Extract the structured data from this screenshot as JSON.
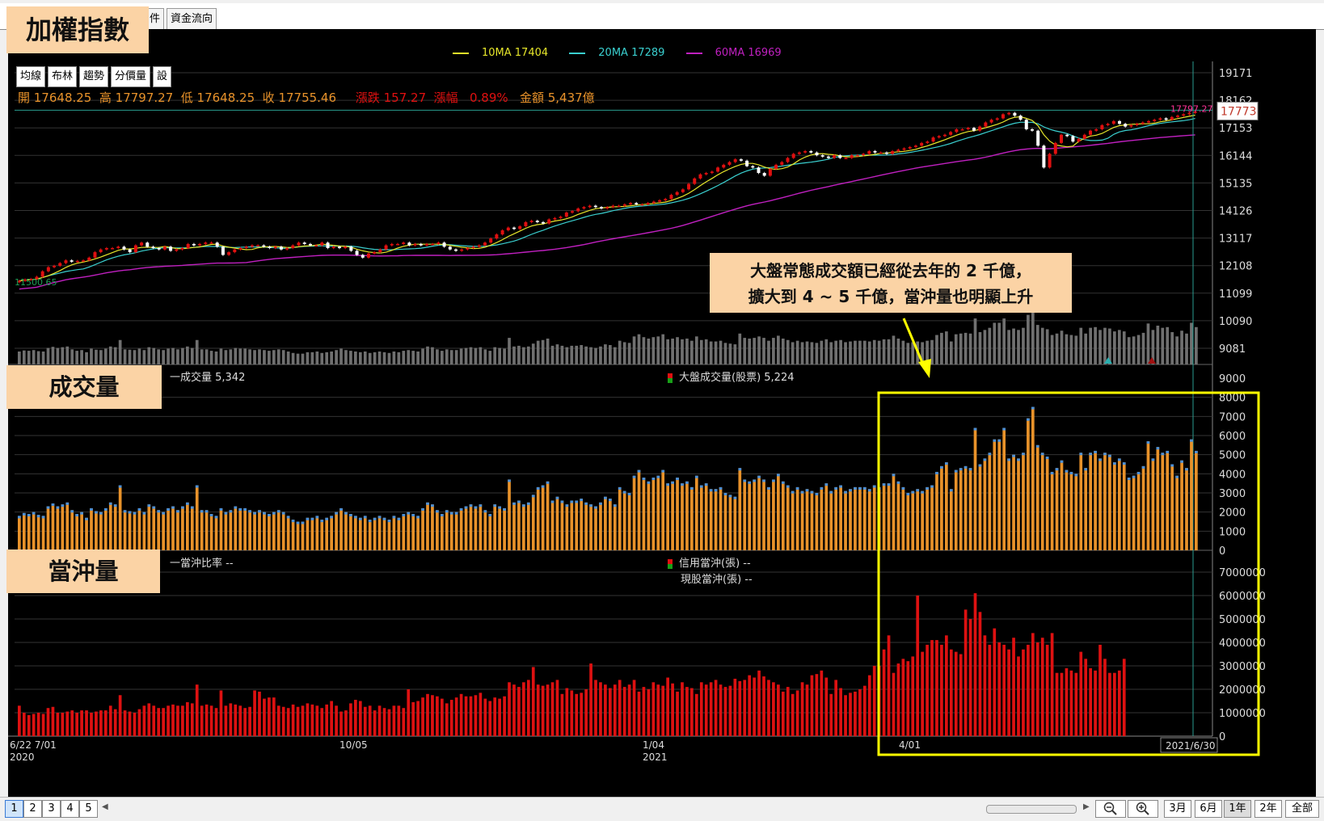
{
  "tabs": [
    "件",
    "資金流向"
  ],
  "overlays": {
    "index_title": "加權指數",
    "volume_title": "成交量",
    "daytrade_title": "當沖量"
  },
  "annotation": {
    "line1": "大盤常態成交額已經從去年的 2 千億，",
    "line2": "擴大到 4 ~ 5 千億，當沖量也明顯上升"
  },
  "legend": {
    "ma10": "10MA 17404",
    "ma20": "20MA 17289",
    "ma60": "60MA 16969"
  },
  "indicator_buttons": [
    "均線",
    "布林",
    "趨勢",
    "分價量",
    "設"
  ],
  "ohlc": {
    "open": "開 17648.25",
    "high": "高 17797.27",
    "low": "低 17648.25",
    "close": "收 17755.46",
    "change": "漲跌 157.27",
    "pct_label": "漲幅",
    "pct": "0.89%",
    "amount": "金額 5,437億"
  },
  "price_axis": [
    "19171",
    "18162",
    "17153",
    "16144",
    "15135",
    "14126",
    "13117",
    "12108",
    "11099",
    "10090",
    "9081"
  ],
  "price_labels": {
    "high_marker": "17797.27",
    "current": "17773",
    "low_marker": "11500.65"
  },
  "volume_legend": {
    "left": "一成交量 5,342",
    "right": "大盤成交量(股票) 5,224"
  },
  "volume_axis": [
    "9000",
    "8000",
    "7000",
    "6000",
    "5000",
    "4000",
    "3000",
    "2000",
    "1000",
    "0"
  ],
  "daytrade_legend": {
    "left": "一當沖比率 --",
    "right1": "信用當沖(張) --",
    "right2": "現股當沖(張) --"
  },
  "daytrade_axis": [
    "7000000",
    "6000000",
    "5000000",
    "4000000",
    "3000000",
    "2000000",
    "1000000",
    "0"
  ],
  "date_axis": [
    {
      "label": "6/22 7/01",
      "sub": "2020"
    },
    {
      "label": "10/05",
      "sub": ""
    },
    {
      "label": "1/04",
      "sub": "2021"
    },
    {
      "label": "4/01",
      "sub": ""
    }
  ],
  "date_current": "2021/6/30",
  "pages": [
    "1",
    "2",
    "3",
    "4",
    "5"
  ],
  "ranges": [
    "3月",
    "6月",
    "1年",
    "2年",
    "全部"
  ],
  "colors": {
    "up": "#e01010",
    "down": "#ffffff",
    "ma10": "#e6e62a",
    "ma20": "#3ad0d0",
    "ma60": "#c020c0",
    "volume": "#e8922a",
    "daytrade": "#dd1111",
    "highlight": "#ffff00"
  },
  "chart_data": {
    "type": "bar",
    "title": "加權指數",
    "series": [
      {
        "name": "成交量",
        "values": [
          1800,
          1950,
          1900,
          2000,
          1850,
          1800,
          2300,
          2450,
          2300,
          2400,
          2500,
          2100,
          1900,
          2000,
          1700,
          2200,
          2050,
          2000,
          2200,
          2500,
          2400,
          3400,
          2100,
          2050,
          2000,
          2200,
          2000,
          2400,
          2300,
          2100,
          2000,
          2200,
          2300,
          2100,
          2300,
          2500,
          2300,
          3400,
          2100,
          2100,
          1900,
          1800,
          2200,
          2000,
          2100,
          2300,
          2200,
          2200,
          2100,
          2000,
          2100,
          2000,
          1900,
          2000,
          2100,
          2000,
          1800,
          1600,
          1500,
          1500,
          1700,
          1700,
          1800,
          1600,
          1700,
          1800,
          2000,
          2200,
          2000,
          1900,
          1800,
          1700,
          1800,
          1600,
          1700,
          1800,
          1700,
          1600,
          1800,
          1700,
          1900,
          2000,
          1900,
          1800,
          2200,
          2500,
          2400,
          2100,
          1900,
          2100,
          2000,
          2000,
          2200,
          2300,
          2400,
          2300,
          2400,
          2100,
          1900,
          2400,
          2300,
          2200,
          3700,
          2500,
          2600,
          2400,
          2500,
          2900,
          3300,
          3400,
          3600,
          2600,
          2800,
          2600,
          2400,
          2600,
          2600,
          2700,
          2500,
          2400,
          2300,
          2500,
          2800,
          2700,
          2400,
          3300,
          3100,
          3000,
          3900,
          4200,
          3800,
          3600,
          3800,
          3900,
          4200,
          3500,
          3600,
          3800,
          3500,
          3600,
          3300,
          3900,
          3400,
          3500,
          3200,
          3200,
          3300,
          3000,
          2900,
          2800,
          4300,
          3700,
          3600,
          3700,
          3900,
          3700,
          3300,
          3700,
          4000,
          3600,
          3400,
          3100,
          3300,
          3100,
          3200,
          3100,
          3000,
          3300,
          3500,
          3100,
          3300,
          3400,
          3100,
          3200,
          3300,
          3300,
          3300,
          3200,
          3400,
          3300,
          3500,
          3500,
          4000,
          3600,
          3300,
          3000,
          3100,
          3200,
          3100,
          3300,
          3400,
          4100,
          4400,
          4600,
          3200,
          4200,
          4300,
          4400,
          4300,
          6400,
          4500,
          4800,
          5100,
          5800,
          5800,
          6400,
          4800,
          5000,
          4800,
          5100,
          6900,
          7500,
          5500,
          5100,
          4900,
          4100,
          4300,
          4700,
          4200,
          4100,
          4000,
          5100,
          4300,
          5100,
          5200,
          4800,
          5100,
          5000,
          4600,
          4800,
          4600,
          3800,
          3900,
          4100,
          4400,
          5700,
          4800,
          5400,
          5100,
          5200,
          4500,
          3900,
          4700,
          4300,
          5800,
          5200
        ]
      },
      {
        "name": "當沖量",
        "values": [
          1300000,
          1000000,
          900000,
          950000,
          1000000,
          950000,
          1200000,
          1250000,
          1000000,
          1000000,
          1050000,
          1100000,
          1000000,
          1100000,
          1100000,
          1000000,
          1050000,
          1100000,
          1100000,
          1300000,
          1150000,
          1750000,
          1100000,
          1050000,
          1000000,
          1150000,
          1300000,
          1400000,
          1300000,
          1200000,
          1200000,
          1300000,
          1350000,
          1300000,
          1300000,
          1450000,
          1400000,
          2200000,
          1300000,
          1350000,
          1300000,
          1200000,
          1950000,
          1300000,
          1400000,
          1350000,
          1300000,
          1200000,
          1250000,
          1950000,
          1900000,
          1600000,
          1650000,
          1650000,
          1300000,
          1250000,
          1200000,
          1350000,
          1250000,
          1300000,
          1400000,
          1350000,
          1300000,
          1200000,
          1350000,
          1500000,
          1300000,
          1050000,
          1100000,
          1400000,
          1550000,
          1500000,
          1250000,
          1300000,
          1100000,
          1300000,
          1200000,
          1150000,
          1300000,
          1300000,
          1200000,
          2000000,
          1450000,
          1500000,
          1650000,
          1800000,
          1750000,
          1700000,
          1600000,
          1400000,
          1550000,
          1650000,
          1800000,
          1700000,
          1700000,
          1750000,
          1850000,
          1600000,
          1500000,
          1650000,
          1600000,
          1700000,
          2300000,
          2200000,
          2100000,
          2300000,
          2400000,
          2950000,
          2200000,
          2150000,
          2200000,
          2300000,
          2400000,
          1800000,
          2050000,
          1950000,
          1800000,
          1850000,
          2000000,
          3100000,
          2400000,
          2300000,
          2200000,
          2050000,
          2200000,
          2400000,
          2100000,
          2200000,
          2400000,
          1900000,
          2100000,
          2000000,
          2300000,
          2200000,
          2150000,
          2500000,
          2250000,
          1900000,
          2300000,
          2100000,
          2050000,
          1800000,
          2300000,
          2200000,
          2300000,
          2400000,
          2200000,
          2100000,
          2150000,
          2450000,
          2350000,
          2400000,
          2600000,
          2500000,
          2800000,
          2550000,
          2400000,
          2300000,
          2200000,
          1900000,
          2100000,
          1800000,
          1950000,
          2300000,
          2200000,
          2600000,
          2650000,
          2800000,
          2500000,
          1800000,
          2400000,
          2050000,
          1750000,
          1850000,
          1900000,
          2000000,
          2150000,
          2600000,
          3000000,
          3000000,
          3700000,
          4300000,
          2700000,
          3100000,
          3300000,
          3200000,
          3400000,
          6000000,
          3600000,
          3900000,
          4100000,
          4100000,
          3900000,
          4300000,
          3700000,
          3600000,
          3500000,
          5400000,
          5000000,
          6100000,
          5300000,
          4300000,
          3900000,
          4600000,
          4000000,
          3900000,
          3700000,
          4200000,
          3400000,
          3700000,
          3900000,
          4400000,
          4000000,
          4200000,
          3900000,
          4400000,
          2700000,
          2700000,
          2900000,
          2800000,
          2700000,
          3600000,
          3300000,
          2900000,
          2800000,
          3900000,
          3300000,
          2700000,
          2700000,
          2800000,
          3300000
        ]
      },
      {
        "name": "10MA 17404",
        "values": []
      },
      {
        "name": "20MA 17289",
        "values": []
      },
      {
        "name": "60MA 16969",
        "values": []
      }
    ],
    "close": [
      11550,
      11600,
      11620,
      11700,
      11900,
      12050,
      12100,
      12200,
      12300,
      12250,
      12280,
      12300,
      12400,
      12600,
      12700,
      12750,
      12750,
      12800,
      12700,
      12600,
      12850,
      12950,
      12800,
      12750,
      12700,
      12800,
      12650,
      12700,
      12750,
      12900,
      12850,
      12900,
      12950,
      12950,
      12800,
      12500,
      12600,
      12700,
      12750,
      12800,
      12850,
      12850,
      12800,
      12750,
      12800,
      12700,
      12750,
      12850,
      12950,
      12900,
      12850,
      12850,
      12950,
      12750,
      12800,
      12750,
      12800,
      12650,
      12500,
      12400,
      12550,
      12600,
      12700,
      12850,
      12900,
      12900,
      12950,
      12850,
      12900,
      12850,
      12900,
      12900,
      12950,
      12800,
      12700,
      12650,
      12700,
      12750,
      12800,
      12850,
      12950,
      13100,
      13250,
      13400,
      13500,
      13450,
      13550,
      13700,
      13750,
      13700,
      13650,
      13800,
      13850,
      13900,
      14050,
      14100,
      14200,
      14250,
      14300,
      14250,
      14200,
      14250,
      14300,
      14300,
      14350,
      14400,
      14350,
      14350,
      14400,
      14450,
      14500,
      14550,
      14700,
      14800,
      14900,
      15100,
      15300,
      15450,
      15500,
      15550,
      15700,
      15800,
      15900,
      16000,
      15950,
      15750,
      15700,
      15500,
      15400,
      15650,
      15800,
      15900,
      16050,
      16200,
      16250,
      16300,
      16250,
      16150,
      16100,
      16050,
      16150,
      16050,
      16050,
      16150,
      16150,
      16200,
      16300,
      16250,
      16250,
      16200,
      16300,
      16350,
      16400,
      16450,
      16500,
      16600,
      16650,
      16800,
      16850,
      16900,
      17000,
      17100,
      17100,
      17150,
      17050,
      17200,
      17350,
      17450,
      17500,
      17650,
      17700,
      17600,
      17450,
      17100,
      17050,
      16500,
      15700,
      16200,
      16600,
      16900,
      16850,
      16650,
      16750,
      16900,
      17050,
      17100,
      17250,
      17300,
      17400,
      17300,
      17200,
      17250,
      17300,
      17350,
      17400,
      17450,
      17500,
      17450,
      17550,
      17600,
      17650,
      17700,
      17750
    ],
    "ylim": [
      9000,
      19300
    ],
    "volume_ylim": [
      0,
      9000
    ],
    "daytrade_ylim": [
      0,
      7000000
    ],
    "grid": true
  }
}
